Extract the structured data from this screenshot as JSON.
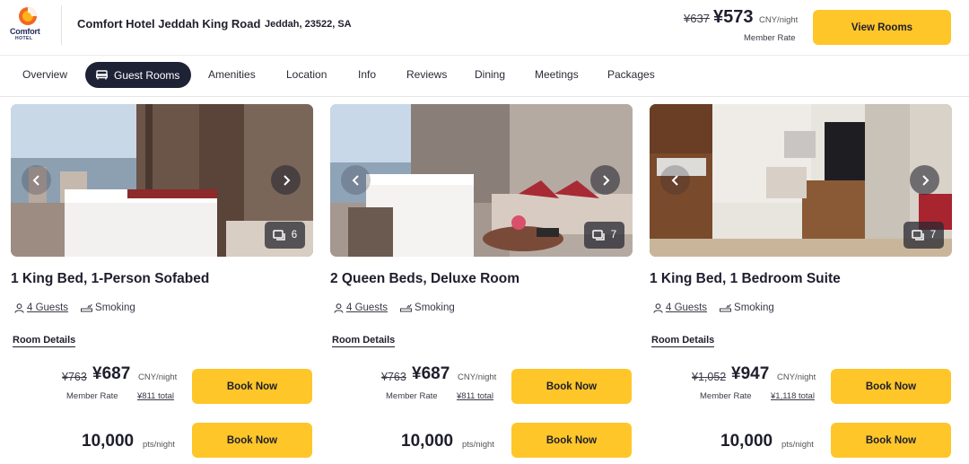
{
  "header": {
    "logo_text": "Comfort",
    "logo_sub": "HOTEL",
    "hotel_name": "Comfort Hotel Jeddah King Road",
    "location": "Jeddah, 23522, SA",
    "old_price": "¥637",
    "new_price": "¥573",
    "price_unit": "CNY/night",
    "member_rate": "Member Rate",
    "view_rooms_label": "View Rooms"
  },
  "tabs": [
    {
      "label": "Overview"
    },
    {
      "label": "Guest Rooms",
      "active": true,
      "icon": "bed-icon"
    },
    {
      "label": "Amenities"
    },
    {
      "label": "Location"
    },
    {
      "label": "Info"
    },
    {
      "label": "Reviews"
    },
    {
      "label": "Dining"
    },
    {
      "label": "Meetings"
    },
    {
      "label": "Packages"
    }
  ],
  "rooms": [
    {
      "title": "1 King Bed, 1-Person Sofabed",
      "photo_count": "6",
      "guests": "4 Guests",
      "smoking": "Smoking",
      "details_label": "Room Details",
      "old_price": "¥763",
      "new_price": "¥687",
      "price_unit": "CNY/night",
      "member_rate": "Member Rate",
      "total": "¥811 total",
      "book_label": "Book Now",
      "points": "10,000",
      "points_unit": "pts/night",
      "book_points_label": "Book Now"
    },
    {
      "title": "2 Queen Beds, Deluxe Room",
      "photo_count": "7",
      "guests": "4 Guests",
      "smoking": "Smoking",
      "details_label": "Room Details",
      "old_price": "¥763",
      "new_price": "¥687",
      "price_unit": "CNY/night",
      "member_rate": "Member Rate",
      "total": "¥811 total",
      "book_label": "Book Now",
      "points": "10,000",
      "points_unit": "pts/night",
      "book_points_label": "Book Now"
    },
    {
      "title": "1 King Bed, 1 Bedroom Suite",
      "photo_count": "7",
      "guests": "4 Guests",
      "smoking": "Smoking",
      "details_label": "Room Details",
      "old_price": "¥1,052",
      "new_price": "¥947",
      "price_unit": "CNY/night",
      "member_rate": "Member Rate",
      "total": "¥1,118 total",
      "book_label": "Book Now",
      "points": "10,000",
      "points_unit": "pts/night",
      "book_points_label": "Book Now"
    }
  ],
  "colors": {
    "accent_yellow": "#ffc629",
    "active_tab": "#1e2235",
    "logo_orange": "#f26722",
    "logo_navy": "#1e2a5a"
  }
}
